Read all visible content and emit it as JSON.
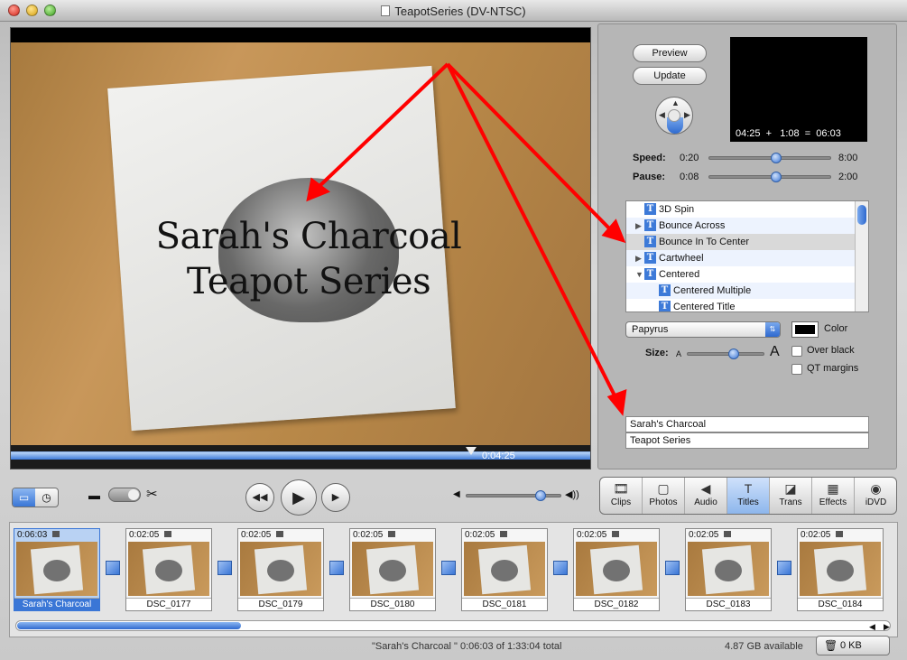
{
  "window": {
    "title": "TeapotSeries (DV-NTSC)"
  },
  "viewer": {
    "title_line1": "Sarah's Charcoal",
    "title_line2": "Teapot Series",
    "playhead_time": "0:04:25"
  },
  "panel": {
    "preview_label": "Preview",
    "update_label": "Update",
    "preview_timing": "04:25  +   1:08  =  06:03",
    "speed_label": "Speed:",
    "speed_min": "0:20",
    "speed_max": "8:00",
    "speed_level": 0.55,
    "pause_label": "Pause:",
    "pause_min": "0:08",
    "pause_max": "2:00",
    "pause_level": 0.55,
    "titles": [
      {
        "label": "3D Spin",
        "expand": "none"
      },
      {
        "label": "Bounce Across",
        "expand": "collapsed"
      },
      {
        "label": "Bounce In To Center",
        "expand": "none",
        "selected": true
      },
      {
        "label": "Cartwheel",
        "expand": "collapsed"
      },
      {
        "label": "Centered",
        "expand": "expanded"
      },
      {
        "label": "Centered Multiple",
        "expand": "child"
      },
      {
        "label": "Centered Title",
        "expand": "child"
      }
    ],
    "font_value": "Papyrus",
    "color_label": "Color",
    "color_value": "#000000",
    "size_label": "Size:",
    "size_small": "A",
    "size_large": "A",
    "size_level": 0.6,
    "over_black_label": "Over black",
    "qt_margins_label": "QT margins",
    "text_line1": "Sarah's Charcoal",
    "text_line2": "Teapot Series"
  },
  "toolbar": {
    "volume_level": 0.78,
    "modes": [
      {
        "label": "Clips",
        "icon": "film-icon"
      },
      {
        "label": "Photos",
        "icon": "photo-icon"
      },
      {
        "label": "Audio",
        "icon": "speaker-icon"
      },
      {
        "label": "Titles",
        "icon": "title-t-icon",
        "active": true
      },
      {
        "label": "Trans",
        "icon": "transition-icon"
      },
      {
        "label": "Effects",
        "icon": "effects-icon"
      },
      {
        "label": "iDVD",
        "icon": "dvd-icon"
      }
    ]
  },
  "clips": [
    {
      "duration": "0:06:03",
      "name": "Sarah's Charcoal",
      "selected": true
    },
    {
      "duration": "0:02:05",
      "name": "DSC_0177"
    },
    {
      "duration": "0:02:05",
      "name": "DSC_0179"
    },
    {
      "duration": "0:02:05",
      "name": "DSC_0180"
    },
    {
      "duration": "0:02:05",
      "name": "DSC_0181"
    },
    {
      "duration": "0:02:05",
      "name": "DSC_0182"
    },
    {
      "duration": "0:02:05",
      "name": "DSC_0183"
    },
    {
      "duration": "0:02:05",
      "name": "DSC_0184"
    }
  ],
  "status": {
    "selection": "\"Sarah's Charcoal \"  0:06:03 of 1:33:04 total",
    "disk": "4.87 GB available",
    "trash": "0 KB"
  },
  "colors": {
    "accent": "#3a76d6",
    "annotation": "#ff0000"
  }
}
